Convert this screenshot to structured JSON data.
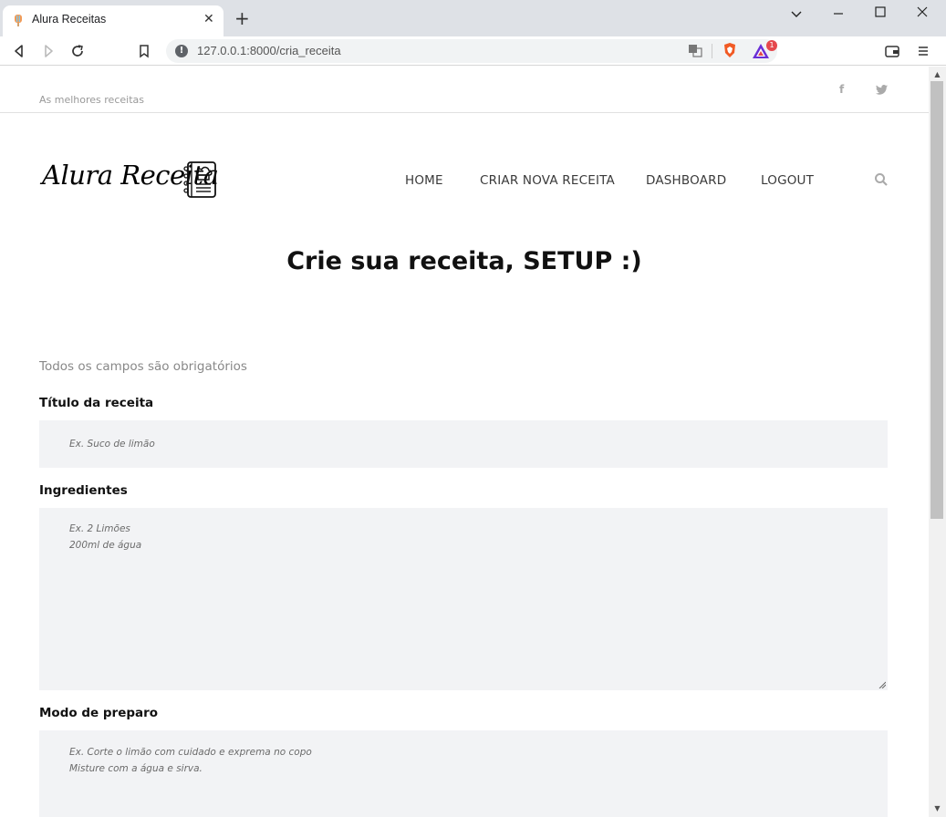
{
  "browser": {
    "tab_title": "Alura Receitas",
    "tab_close": "✕",
    "new_tab": "+",
    "url": "127.0.0.1:8000/cria_receita",
    "rewards_badge": "1"
  },
  "site": {
    "tagline": "As melhores receitas",
    "logo_text": "Alura Receita",
    "social": {
      "facebook": "f",
      "twitter": "t"
    },
    "nav": [
      "HOME",
      "CRIAR NOVA RECEITA",
      "DASHBOARD",
      "LOGOUT"
    ]
  },
  "page": {
    "title": "Crie sua receita, SETUP :)",
    "required_note": "Todos os campos são obrigatórios"
  },
  "form": {
    "titulo": {
      "label": "Título da receita",
      "placeholder": "Ex. Suco de limão"
    },
    "ingredientes": {
      "label": "Ingredientes",
      "placeholder_line1": "Ex. 2 Limões",
      "placeholder_line2": "200ml de água"
    },
    "modo": {
      "label": "Modo de preparo",
      "placeholder_line1": "Ex. Corte o limão com cuidado e exprema no copo",
      "placeholder_line2": "Misture com a água e sirva."
    }
  }
}
